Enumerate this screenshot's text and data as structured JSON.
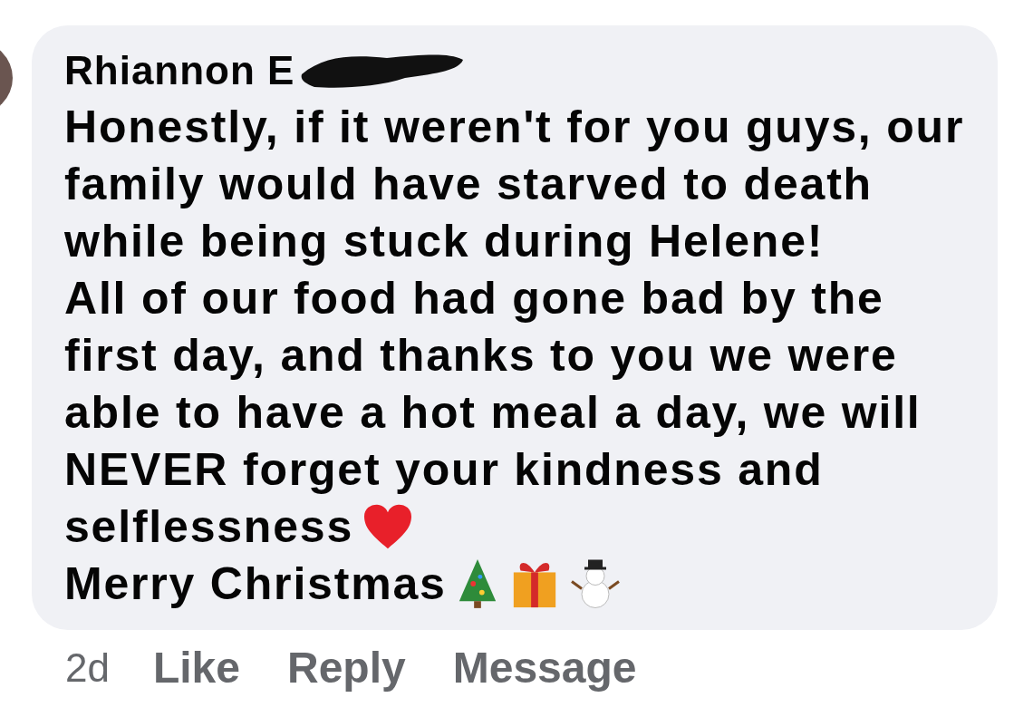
{
  "comment": {
    "author": "Rhiannon E",
    "lines": [
      {
        "text": "Honestly, if it weren't for you guys, our"
      },
      {
        "text": "family would have starved to death"
      },
      {
        "text": "while being stuck during Helene!"
      },
      {
        "text": "All of our food had gone bad by the"
      },
      {
        "text": "first day, and thanks to you we were"
      },
      {
        "text": "able to have a hot meal a day, we will"
      },
      {
        "text": "NEVER forget your kindness and"
      },
      {
        "text": "selflessness",
        "icons": [
          {
            "kind": "heart"
          }
        ]
      },
      {
        "text": "Merry Christmas",
        "icons": [
          {
            "kind": "tree"
          },
          {
            "kind": "gift"
          },
          {
            "kind": "snowman"
          }
        ]
      }
    ]
  },
  "actions": {
    "time": "2d",
    "buttons": [
      "Like",
      "Reply",
      "Message"
    ]
  }
}
